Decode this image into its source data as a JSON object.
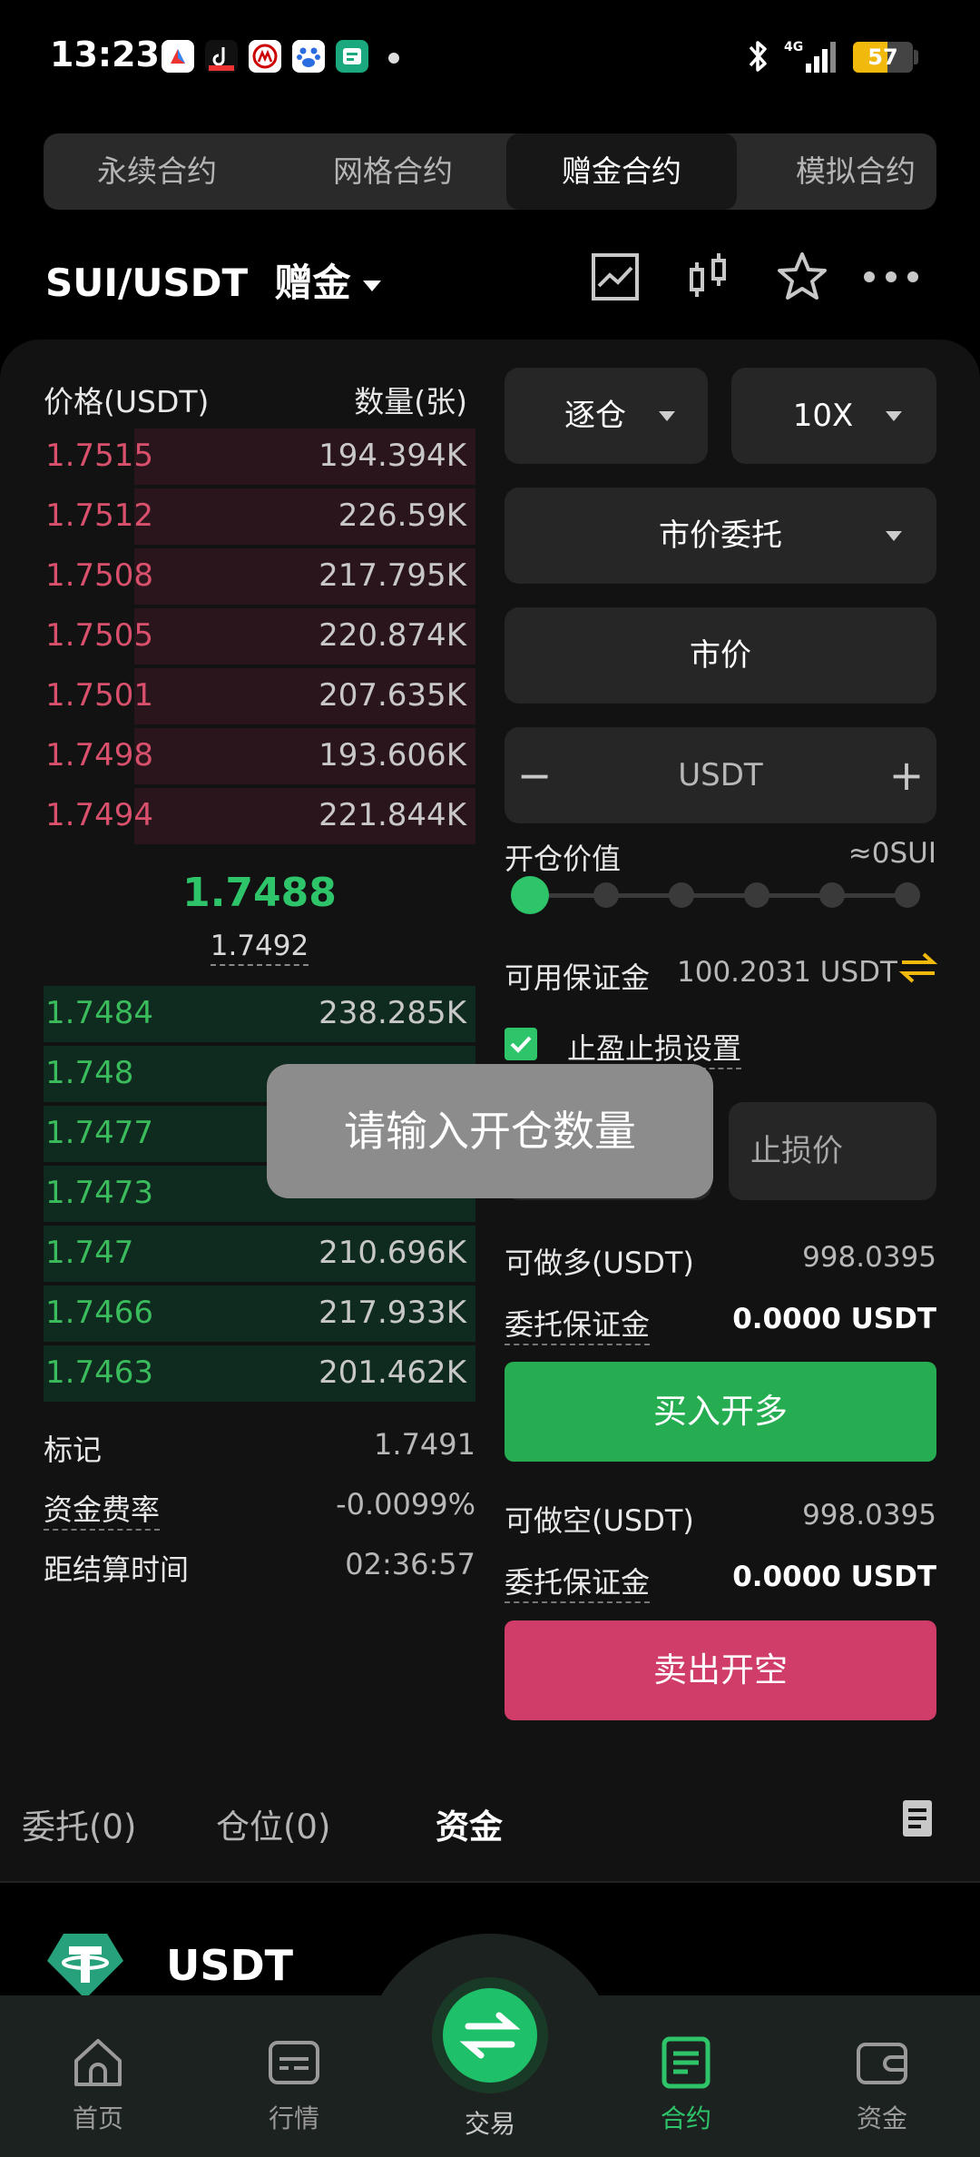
{
  "status_bar": {
    "time": "13:23",
    "battery": "57",
    "network": "4G"
  },
  "contract_tabs": [
    "永续合约",
    "网格合约",
    "赠金合约",
    "模拟合约"
  ],
  "header": {
    "pair": "SUI/USDT",
    "mode": "赠金"
  },
  "orderbook": {
    "price_header": "价格(USDT)",
    "qty_header": "数量(张)",
    "asks": [
      {
        "price": "1.7515",
        "qty": "194.394K"
      },
      {
        "price": "1.7512",
        "qty": "226.59K"
      },
      {
        "price": "1.7508",
        "qty": "217.795K"
      },
      {
        "price": "1.7505",
        "qty": "220.874K"
      },
      {
        "price": "1.7501",
        "qty": "207.635K"
      },
      {
        "price": "1.7498",
        "qty": "193.606K"
      },
      {
        "price": "1.7494",
        "qty": "221.844K"
      }
    ],
    "last_price": "1.7488",
    "mark_price": "1.7492",
    "bids": [
      {
        "price": "1.7484",
        "qty": "238.285K"
      },
      {
        "price": "1.748",
        "qty": ""
      },
      {
        "price": "1.7477",
        "qty": ""
      },
      {
        "price": "1.7473",
        "qty": ""
      },
      {
        "price": "1.747",
        "qty": "210.696K"
      },
      {
        "price": "1.7466",
        "qty": "217.933K"
      },
      {
        "price": "1.7463",
        "qty": "201.462K"
      }
    ]
  },
  "market_info": {
    "mark_label": "标记",
    "mark_value": "1.7491",
    "funding_label": "资金费率",
    "funding_value": "-0.0099%",
    "settle_label": "距结算时间",
    "settle_value": "02:36:57"
  },
  "order_form": {
    "margin_mode": "逐仓",
    "leverage": "10X",
    "order_type": "市价委托",
    "price_field": "市价",
    "amount_minus": "−",
    "amount_unit": "USDT",
    "amount_plus": "+",
    "open_value_label": "开仓价值",
    "open_value": "≈0SUI",
    "slider_level": 0,
    "available_label": "可用保证金",
    "available_value": "100.2031 USDT",
    "tpsl_checked": true,
    "tpsl_label": "止盈止损设置",
    "stop_loss_placeholder": "止损价",
    "long_max_label": "可做多(USDT)",
    "long_max_value": "998.0395",
    "long_margin_label": "委托保证金",
    "long_margin_value": "0.0000 USDT",
    "buy_button": "买入开多",
    "short_max_label": "可做空(USDT)",
    "short_max_value": "998.0395",
    "short_margin_label": "委托保证金",
    "short_margin_value": "0.0000 USDT",
    "sell_button": "卖出开空"
  },
  "toast": "请输入开仓数量",
  "bottom_tabs": [
    "委托(0)",
    "仓位(0)",
    "资金"
  ],
  "asset": {
    "name": "USDT"
  },
  "nav": [
    "首页",
    "行情",
    "交易",
    "合约",
    "资金"
  ],
  "colors": {
    "green": "#2ec46a",
    "red": "#d9506d",
    "buy": "#26ad52",
    "sell": "#cf3d68",
    "accent": "#f0b90b"
  }
}
